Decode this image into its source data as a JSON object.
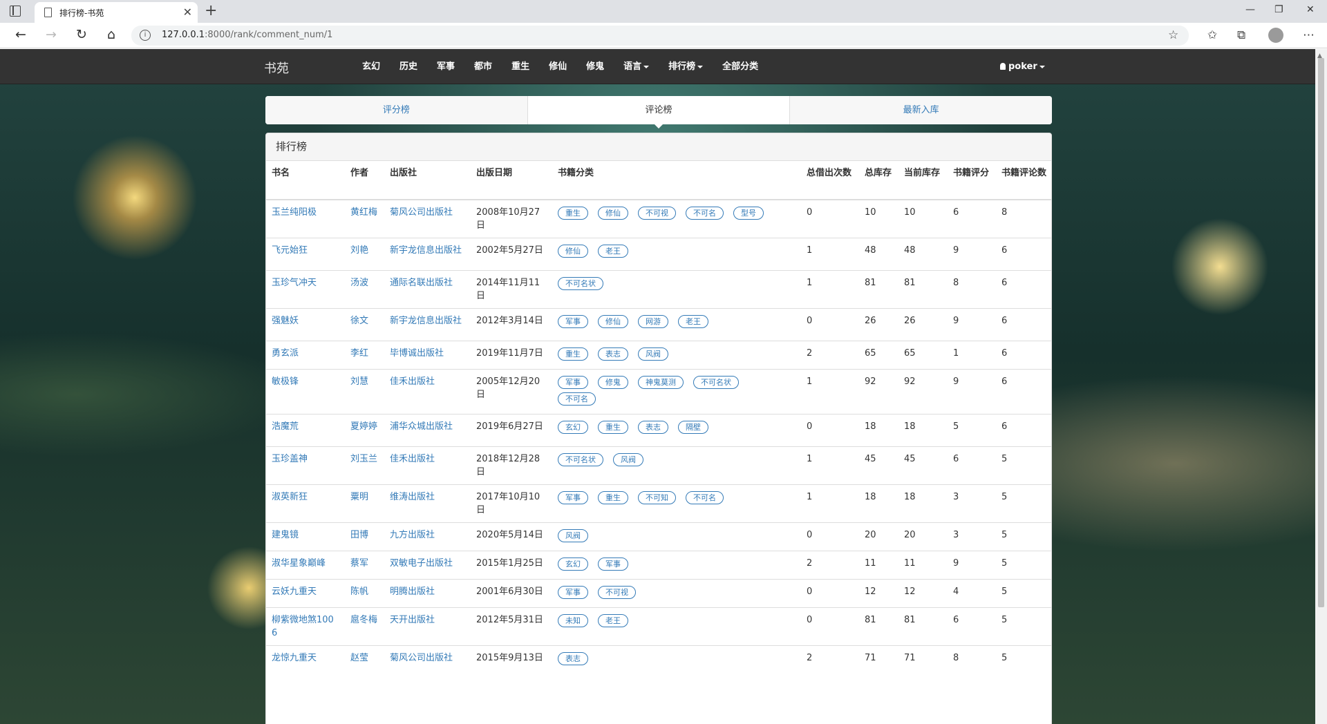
{
  "browser": {
    "tab_title": "排行榜-书苑",
    "tab_close": "✕",
    "new_tab": "+",
    "url_host": "127.0.0.1",
    "url_path": ":8000/rank/comment_num/1",
    "minimize": "—",
    "restore": "❐",
    "close": "✕"
  },
  "navbar": {
    "brand": "书苑",
    "items": [
      {
        "label": "玄幻"
      },
      {
        "label": "历史"
      },
      {
        "label": "军事"
      },
      {
        "label": "都市"
      },
      {
        "label": "重生"
      },
      {
        "label": "修仙"
      },
      {
        "label": "修鬼"
      }
    ],
    "dropdowns": [
      {
        "label": "语言"
      },
      {
        "label": "排行榜"
      }
    ],
    "all_label": "全部分类",
    "user": "poker"
  },
  "rank_tabs": [
    {
      "label": "评分榜"
    },
    {
      "label": "评论榜"
    },
    {
      "label": "最新入库"
    }
  ],
  "panel": {
    "title": "排行榜",
    "headers": [
      "书名",
      "作者",
      "出版社",
      "出版日期",
      "书籍分类",
      "总借出次数",
      "总库存",
      "当前库存",
      "书籍评分",
      "书籍评论数"
    ],
    "rows": [
      {
        "name": "玉兰纯阳极",
        "author": "黄红梅",
        "publisher": "菊风公司出版社",
        "date": "2008年10月27日",
        "tags": [
          "重生",
          "修仙",
          "不可视",
          "不可名",
          "型号"
        ],
        "borrow": "0",
        "total": "10",
        "current": "10",
        "score": "6",
        "comments": "8"
      },
      {
        "name": "飞元始狂",
        "author": "刘艳",
        "publisher": "新宇龙信息出版社",
        "date": "2002年5月27日",
        "tags": [
          "修仙",
          "老王"
        ],
        "borrow": "1",
        "total": "48",
        "current": "48",
        "score": "9",
        "comments": "6"
      },
      {
        "name": "玉珍气冲天",
        "author": "汤波",
        "publisher": "通际名联出版社",
        "date": "2014年11月11日",
        "tags": [
          "不可名状"
        ],
        "borrow": "1",
        "total": "81",
        "current": "81",
        "score": "8",
        "comments": "6"
      },
      {
        "name": "强魅妖",
        "author": "徐文",
        "publisher": "新宇龙信息出版社",
        "date": "2012年3月14日",
        "tags": [
          "军事",
          "修仙",
          "网游",
          "老王"
        ],
        "borrow": "0",
        "total": "26",
        "current": "26",
        "score": "9",
        "comments": "6"
      },
      {
        "name": "勇玄派",
        "author": "李红",
        "publisher": "毕博诚出版社",
        "date": "2019年11月7日",
        "tags": [
          "重生",
          "表志",
          "风阀"
        ],
        "borrow": "2",
        "total": "65",
        "current": "65",
        "score": "1",
        "comments": "6"
      },
      {
        "name": "敏极锋",
        "author": "刘慧",
        "publisher": "佳禾出版社",
        "date": "2005年12月20日",
        "tags": [
          "军事",
          "修鬼",
          "神鬼莫测",
          "不可名状",
          "不可名"
        ],
        "borrow": "1",
        "total": "92",
        "current": "92",
        "score": "9",
        "comments": "6"
      },
      {
        "name": "浩魔荒",
        "author": "夏婷婷",
        "publisher": "浦华众城出版社",
        "date": "2019年6月27日",
        "tags": [
          "玄幻",
          "重生",
          "表志",
          "隔壁"
        ],
        "borrow": "0",
        "total": "18",
        "current": "18",
        "score": "5",
        "comments": "6"
      },
      {
        "name": "玉珍盖神",
        "author": "刘玉兰",
        "publisher": "佳禾出版社",
        "date": "2018年12月28日",
        "tags": [
          "不可名状",
          "风阀"
        ],
        "borrow": "1",
        "total": "45",
        "current": "45",
        "score": "6",
        "comments": "5"
      },
      {
        "name": "淑英新狂",
        "author": "粟明",
        "publisher": "维涛出版社",
        "date": "2017年10月10日",
        "tags": [
          "军事",
          "重生",
          "不可知",
          "不可名"
        ],
        "borrow": "1",
        "total": "18",
        "current": "18",
        "score": "3",
        "comments": "5"
      },
      {
        "name": "建鬼镜",
        "author": "田博",
        "publisher": "九方出版社",
        "date": "2020年5月14日",
        "tags": [
          "风阀"
        ],
        "borrow": "0",
        "total": "20",
        "current": "20",
        "score": "3",
        "comments": "5"
      },
      {
        "name": "淑华星象巅峰",
        "author": "蔡军",
        "publisher": "双敏电子出版社",
        "date": "2015年1月25日",
        "tags": [
          "玄幻",
          "军事"
        ],
        "borrow": "2",
        "total": "11",
        "current": "11",
        "score": "9",
        "comments": "5"
      },
      {
        "name": "云妖九重天",
        "author": "陈帆",
        "publisher": "明腾出版社",
        "date": "2001年6月30日",
        "tags": [
          "军事",
          "不可视"
        ],
        "borrow": "0",
        "total": "12",
        "current": "12",
        "score": "4",
        "comments": "5"
      },
      {
        "name": "柳紫微地煞1006",
        "author": "扈冬梅",
        "publisher": "天开出版社",
        "date": "2012年5月31日",
        "tags": [
          "未知",
          "老王"
        ],
        "borrow": "0",
        "total": "81",
        "current": "81",
        "score": "6",
        "comments": "5"
      },
      {
        "name": "龙惊九重天",
        "author": "赵莹",
        "publisher": "菊风公司出版社",
        "date": "2015年9月13日",
        "tags": [
          "表志"
        ],
        "borrow": "2",
        "total": "71",
        "current": "71",
        "score": "8",
        "comments": "5"
      }
    ]
  },
  "colors": {
    "navbar_bg": "#333333",
    "link": "#337ab7",
    "panel_heading_bg": "#f5f5f5"
  }
}
